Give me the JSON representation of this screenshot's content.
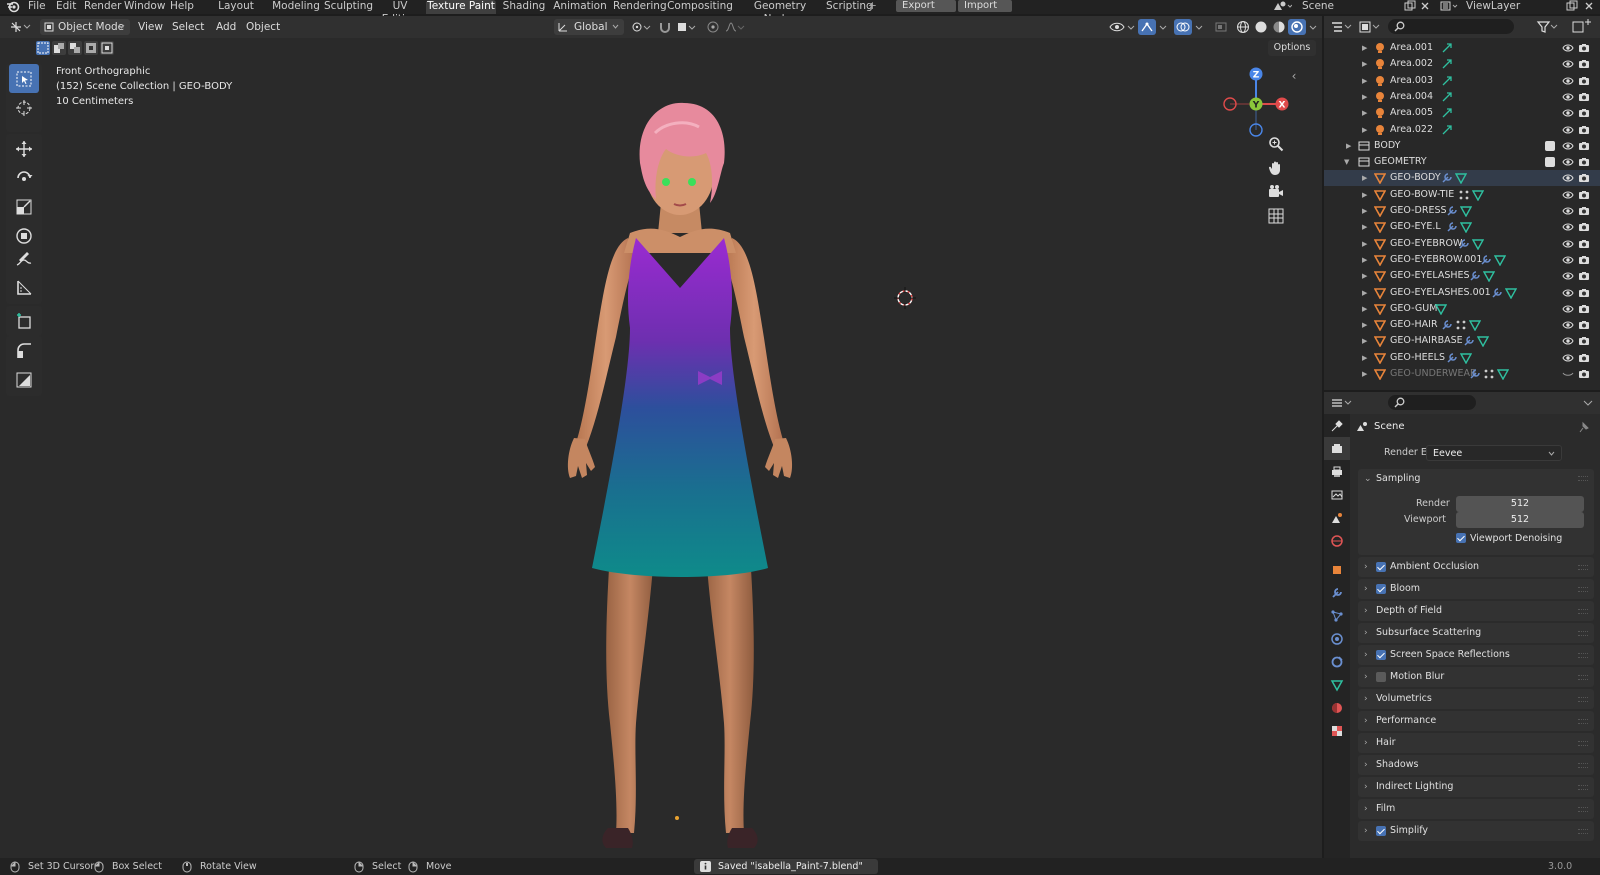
{
  "menu": [
    "File",
    "Edit",
    "Render",
    "Window",
    "Help"
  ],
  "workspace_tabs": [
    "Layout",
    "Modeling",
    "Sculpting",
    "UV Editing",
    "Texture Paint",
    "Shading",
    "Animation",
    "Rendering",
    "Compositing",
    "Geometry Nodes",
    "Scripting"
  ],
  "active_workspace": "Texture Paint",
  "export_label": "Export",
  "import_label": "Import",
  "scene_name": "Scene",
  "view_layer": "ViewLayer",
  "viewport_header": {
    "mode": "Object Mode",
    "menus": [
      "View",
      "Select",
      "Add",
      "Object"
    ],
    "transform_orientation": "Global",
    "options_label": "Options"
  },
  "viewport_info": {
    "view_name": "Front Orthographic",
    "collection": "(152) Scene Collection | GEO-BODY",
    "scale": "10 Centimeters"
  },
  "gizmo": {
    "z": "Z",
    "y": "Y",
    "x": "X"
  },
  "outliner_rows": [
    {
      "name": "Area.001",
      "type": "light"
    },
    {
      "name": "Area.002",
      "type": "light"
    },
    {
      "name": "Area.003",
      "type": "light"
    },
    {
      "name": "Area.004",
      "type": "light"
    },
    {
      "name": "Area.005",
      "type": "light"
    },
    {
      "name": "Area.022",
      "type": "light"
    },
    {
      "name": "BODY",
      "type": "collection"
    },
    {
      "name": "GEOMETRY",
      "type": "collection"
    },
    {
      "name": "GEO-BODY",
      "type": "mesh"
    },
    {
      "name": "GEO-BOW-TIE",
      "type": "mesh"
    },
    {
      "name": "GEO-DRESS",
      "type": "mesh"
    },
    {
      "name": "GEO-EYE.L",
      "type": "mesh"
    },
    {
      "name": "GEO-EYEBROW",
      "type": "mesh"
    },
    {
      "name": "GEO-EYEBROW.001",
      "type": "mesh"
    },
    {
      "name": "GEO-EYELASHES",
      "type": "mesh"
    },
    {
      "name": "GEO-EYELASHES.001",
      "type": "mesh"
    },
    {
      "name": "GEO-GUM",
      "type": "mesh"
    },
    {
      "name": "GEO-HAIR",
      "type": "mesh"
    },
    {
      "name": "GEO-HAIRBASE",
      "type": "mesh"
    },
    {
      "name": "GEO-HEELS",
      "type": "mesh"
    },
    {
      "name": "GEO-UNDERWEAR",
      "type": "mesh"
    }
  ],
  "properties": {
    "context": "Scene",
    "render_engine_label": "Render Engine",
    "render_engine": "Eevee",
    "sampling_label": "Sampling",
    "render_label": "Render",
    "render_samples": "512",
    "viewport_label": "Viewport",
    "viewport_samples": "512",
    "denoise_label": "Viewport Denoising",
    "panels": [
      {
        "label": "Ambient Occlusion",
        "checkbox": true,
        "checked": true
      },
      {
        "label": "Bloom",
        "checkbox": true,
        "checked": true
      },
      {
        "label": "Depth of Field",
        "checkbox": false
      },
      {
        "label": "Subsurface Scattering",
        "checkbox": false
      },
      {
        "label": "Screen Space Reflections",
        "checkbox": true,
        "checked": true
      },
      {
        "label": "Motion Blur",
        "checkbox": true,
        "checked": false
      },
      {
        "label": "Volumetrics",
        "checkbox": false
      },
      {
        "label": "Performance",
        "checkbox": false
      },
      {
        "label": "Hair",
        "checkbox": false
      },
      {
        "label": "Shadows",
        "checkbox": false
      },
      {
        "label": "Indirect Lighting",
        "checkbox": false
      },
      {
        "label": "Film",
        "checkbox": false
      },
      {
        "label": "Simplify",
        "checkbox": true,
        "checked": true
      }
    ]
  },
  "status": {
    "hint1": "Set 3D Cursor",
    "hint2": "Box Select",
    "hint3": "Rotate View",
    "hint4": "Select",
    "hint5": "Move",
    "message": "Saved \"isabella_Paint-7.blend\"",
    "version": "3.0.0"
  },
  "colors": {
    "accent": "#4772b3",
    "header": "#303030",
    "viewport_bg": "#2a2a2a",
    "light_icon": "#e8843a",
    "mesh_icon": "#e8843a",
    "data_icon": "#2fc0a0",
    "modifier_icon": "#6a8fd0"
  }
}
